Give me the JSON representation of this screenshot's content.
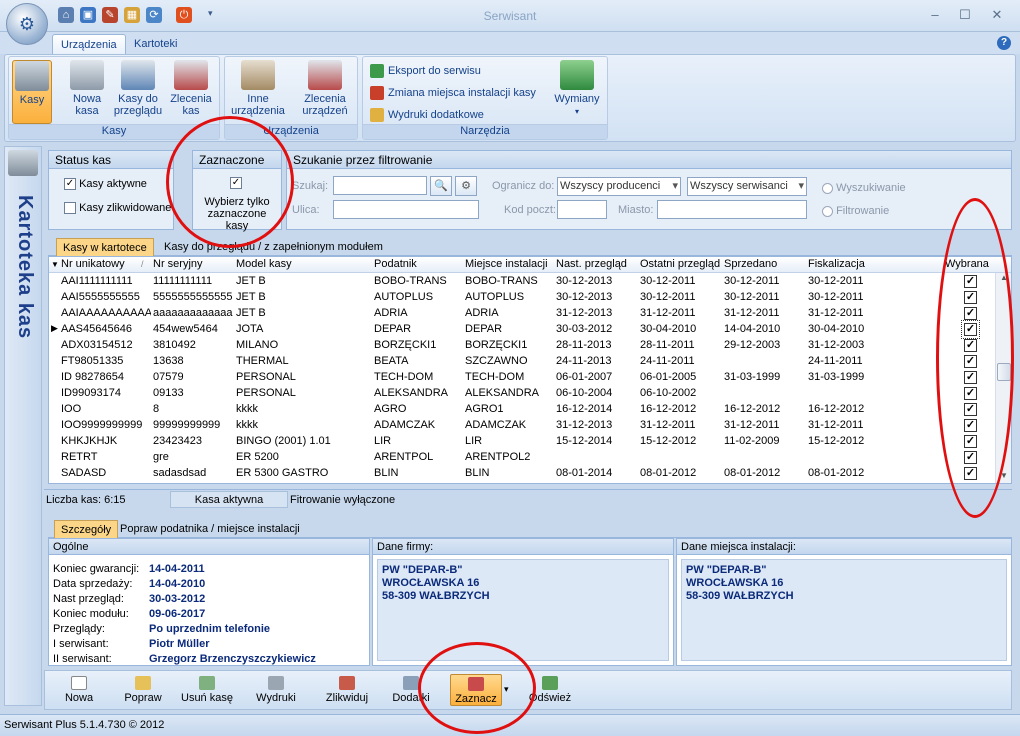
{
  "window": {
    "title": "Serwisant"
  },
  "ribbon_tabs": [
    "Urządzenia",
    "Kartoteki"
  ],
  "ribbon": {
    "group_kasy": {
      "label": "Kasy",
      "buttons": [
        "Kasy",
        "Nowa kasa",
        "Kasy do przeglądu",
        "Zlecenia kas"
      ]
    },
    "group_urzadzenia": {
      "label": "Urządzenia",
      "buttons": [
        "Inne urządzenia",
        "Zlecenia urządzeń"
      ]
    },
    "group_narzedzia": {
      "label": "Narzędzia",
      "buttons": [
        "Eksport do serwisu",
        "Zmiana miejsca instalacji kasy",
        "Wydruki dodatkowe"
      ],
      "big": "Wymiany"
    }
  },
  "sidebar": {
    "title": "Kartoteka kas"
  },
  "status_kas": {
    "title": "Status kas",
    "aktywne": "Kasy aktywne",
    "zlikwidowane": "Kasy zlikwidowane"
  },
  "zaznaczone": {
    "title": "Zaznaczone",
    "label": "Wybierz tylko zaznaczone kasy"
  },
  "filter": {
    "title": "Szukanie przez filtrowanie",
    "szukaj": "Szukaj:",
    "ulica": "Ulica:",
    "ogranicz": "Ogranicz do:",
    "kod": "Kod poczt:",
    "miasto": "Miasto:",
    "producenci": "Wszyscy producenci",
    "serwisanci": "Wszyscy serwisanci",
    "wyszukiwanie": "Wyszukiwanie",
    "filtrowanie": "Filtrowanie"
  },
  "grid_tabs": [
    "Kasy w kartotece",
    "Kasy do przeglądu / z zapełnionym modułem"
  ],
  "columns": [
    "Nr unikatowy",
    "Nr seryjny",
    "Model kasy",
    "Podatnik",
    "Miejsce instalacji",
    "Nast. przegląd",
    "Ostatni przegląd",
    "Sprzedano",
    "Fiskalizacja",
    "Wybrana"
  ],
  "rows": [
    [
      "AAI1111111111",
      "11111111111",
      "JET B",
      "BOBO-TRANS",
      "BOBO-TRANS",
      "30-12-2013",
      "30-12-2011",
      "30-12-2011",
      "30-12-2011"
    ],
    [
      "AAI5555555555",
      "5555555555555",
      "JET B",
      "AUTOPLUS",
      "AUTOPLUS",
      "30-12-2013",
      "30-12-2011",
      "30-12-2011",
      "30-12-2011"
    ],
    [
      "AAIAAAAAAAAAA",
      "aaaaaaaaaaaaa",
      "JET B",
      "ADRIA",
      "ADRIA",
      "31-12-2013",
      "31-12-2011",
      "31-12-2011",
      "31-12-2011"
    ],
    [
      "AAS45645646",
      "454wew5464",
      "JOTA",
      "DEPAR",
      "DEPAR",
      "30-03-2012",
      "30-04-2010",
      "14-04-2010",
      "30-04-2010"
    ],
    [
      "ADX03154512",
      "3810492",
      "MILANO",
      "BORZĘCKI1",
      "BORZĘCKI1",
      "28-11-2013",
      "28-11-2011",
      "29-12-2003",
      "31-12-2003"
    ],
    [
      "FT98051335",
      "13638",
      "THERMAL",
      "BEATA",
      "SZCZAWNO",
      "24-11-2013",
      "24-11-2011",
      "",
      "24-11-2011"
    ],
    [
      "ID 98278654",
      "07579",
      "PERSONAL",
      "TECH-DOM",
      "TECH-DOM",
      "06-01-2007",
      "06-01-2005",
      "31-03-1999",
      "31-03-1999"
    ],
    [
      "ID99093174",
      "09133",
      "PERSONAL",
      "ALEKSANDRA",
      "ALEKSANDRA",
      "06-10-2004",
      "06-10-2002",
      "",
      ""
    ],
    [
      "IOO",
      "8",
      "kkkk",
      "AGRO",
      "AGRO1",
      "16-12-2014",
      "16-12-2012",
      "16-12-2012",
      "16-12-2012"
    ],
    [
      "IOO9999999999",
      "99999999999",
      "kkkk",
      "ADAMCZAK",
      "ADAMCZAK",
      "31-12-2013",
      "31-12-2011",
      "31-12-2011",
      "31-12-2011"
    ],
    [
      "KHKJKHJK",
      "23423423",
      "BINGO (2001) 1.01",
      "LIR",
      "LIR",
      "15-12-2014",
      "15-12-2012",
      "11-02-2009",
      "15-12-2012"
    ],
    [
      "RETRT",
      "gre",
      "ER 5200",
      "ARENTPOL",
      "ARENTPOL2",
      "",
      "",
      "",
      ""
    ],
    [
      "SADASD",
      "sadasdsad",
      "ER 5300 GASTRO",
      "BLIN",
      "BLIN",
      "08-01-2014",
      "08-01-2012",
      "08-01-2012",
      "08-01-2012"
    ]
  ],
  "status": {
    "count": "Liczba kas:  6:15",
    "active": "Kasa aktywna",
    "filter": "Fitrowanie wyłączone"
  },
  "detail_tabs": [
    "Szczegóły",
    "Popraw podatnika / miejsce instalacji"
  ],
  "ogolne": {
    "title": "Ogólne",
    "items": [
      {
        "k": "Koniec gwarancji:",
        "v": "14-04-2011"
      },
      {
        "k": "Data sprzedaży:",
        "v": "14-04-2010"
      },
      {
        "k": "Nast przegląd:",
        "v": "30-03-2012"
      },
      {
        "k": "Koniec modułu:",
        "v": "09-06-2017"
      },
      {
        "k": "Przeglądy:",
        "v": "Po uprzednim telefonie"
      },
      {
        "k": "I serwisant:",
        "v": "Piotr Müller"
      },
      {
        "k": "II serwisant:",
        "v": "Grzegorz Brzenczyszczykiewicz"
      }
    ]
  },
  "firma": {
    "title": "Dane firmy:",
    "lines": [
      "PW \"DEPAR-B\"",
      "WROCŁAWSKA 16",
      "58-309 WAŁBRZYCH"
    ]
  },
  "miejsce": {
    "title": "Dane miejsca instalacji:",
    "lines": [
      "PW \"DEPAR-B\"",
      "WROCŁAWSKA 16",
      "58-309 WAŁBRZYCH"
    ]
  },
  "toolbar": [
    "Nowa",
    "Popraw",
    "Usuń kasę",
    "Wydruki",
    "Zlikwiduj",
    "Dodatki",
    "Zaznacz",
    "Odśwież"
  ],
  "statusbar": {
    "version": "Serwisant Plus 5.1.4.730 © 2012"
  }
}
